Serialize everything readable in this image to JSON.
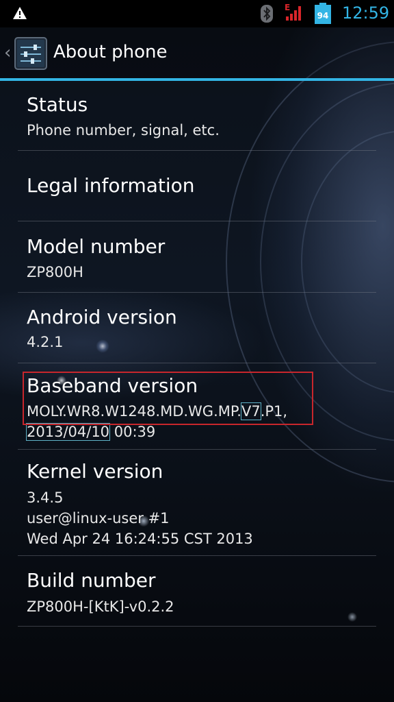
{
  "status_bar": {
    "time": "12:59",
    "battery_level": "94",
    "signal_label": "E",
    "icons": [
      "warning-icon",
      "bluetooth-icon",
      "signal-icon",
      "battery-icon"
    ]
  },
  "action_bar": {
    "title": "About phone",
    "icon": "settings-icon"
  },
  "colors": {
    "accent": "#33b5e5",
    "highlight": "#c8262c",
    "signal": "#d9252a"
  },
  "items": [
    {
      "title": "Status",
      "summary": [
        "Phone number, signal, etc."
      ]
    },
    {
      "title": "Legal information",
      "summary": []
    },
    {
      "title": "Model number",
      "summary": [
        "ZP800H"
      ]
    },
    {
      "title": "Android version",
      "summary": [
        "4.2.1"
      ]
    },
    {
      "title": "Baseband version",
      "summary": [
        "MOLY.WR8.W1248.MD.WG.MP.V7.P1,",
        "2013/04/10 00:39"
      ],
      "summary_parts": {
        "prefix": "MOLY.WR8.W1248.MD.WG.MP.",
        "boxed": "V7",
        "suffix": ".P1,",
        "date": "2013/04/10",
        "time": " 00:39"
      }
    },
    {
      "title": "Kernel version",
      "summary": [
        "3.4.5",
        "user@linux-user #1",
        "Wed Apr 24 16:24:55 CST 2013"
      ]
    },
    {
      "title": "Build number",
      "summary": [
        "ZP800H-[KtK]-v0.2.2"
      ]
    }
  ]
}
